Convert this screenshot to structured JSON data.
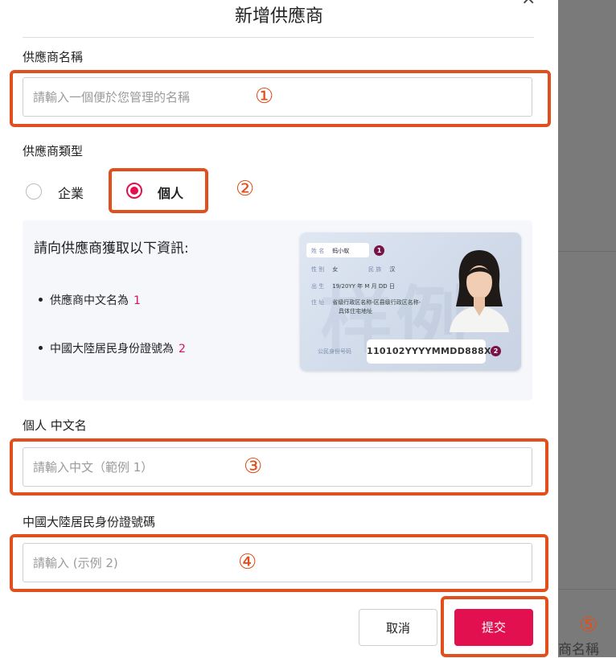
{
  "background": {
    "right_label": "商名稱"
  },
  "modal": {
    "title": "新增供應商",
    "close_label": "×",
    "name_field": {
      "label": "供應商名稱",
      "placeholder": "請輸入一個便於您管理的名稱"
    },
    "type_field": {
      "label": "供應商類型",
      "options": [
        {
          "label": "企業",
          "selected": false
        },
        {
          "label": "個人",
          "selected": true
        }
      ]
    },
    "info_panel": {
      "title": "請向供應商獲取以下資訊:",
      "bullets": [
        {
          "text": "供應商中文名為",
          "ref": "1"
        },
        {
          "text": "中國大陸居民身份證號為",
          "ref": "2"
        }
      ],
      "id_card": {
        "name_label": "姓 名",
        "name_value": "蚂小蚁",
        "gender_label": "性 别",
        "gender_value": "女",
        "ethnic_label": "民 族",
        "ethnic_value": "汉",
        "birth_label": "出 生",
        "birth_value": "19/20YY   年  M  月  DD  日",
        "address_label": "住 址",
        "address_value_1": "省级行政区名称-区县级行政区名称-",
        "address_value_2": "具体住宅地址",
        "id_label": "公民身份号码",
        "id_value": "110102YYYYMMDD888X",
        "badge_1": "1",
        "badge_2": "2",
        "watermark": "样例"
      }
    },
    "chinese_name_field": {
      "label": "個人 中文名",
      "placeholder": "請輸入中文（範例 1）"
    },
    "id_number_field": {
      "label": "中國大陸居民身份證號碼",
      "placeholder": "請輸入 (示例 2)"
    },
    "buttons": {
      "cancel": "取消",
      "submit": "提交"
    },
    "annotations": {
      "step1": "①",
      "step2": "②",
      "step3": "③",
      "step4": "④",
      "step5": "⑤"
    }
  },
  "colors": {
    "accent": "#e3104f",
    "annotation": "#e04f1c"
  }
}
